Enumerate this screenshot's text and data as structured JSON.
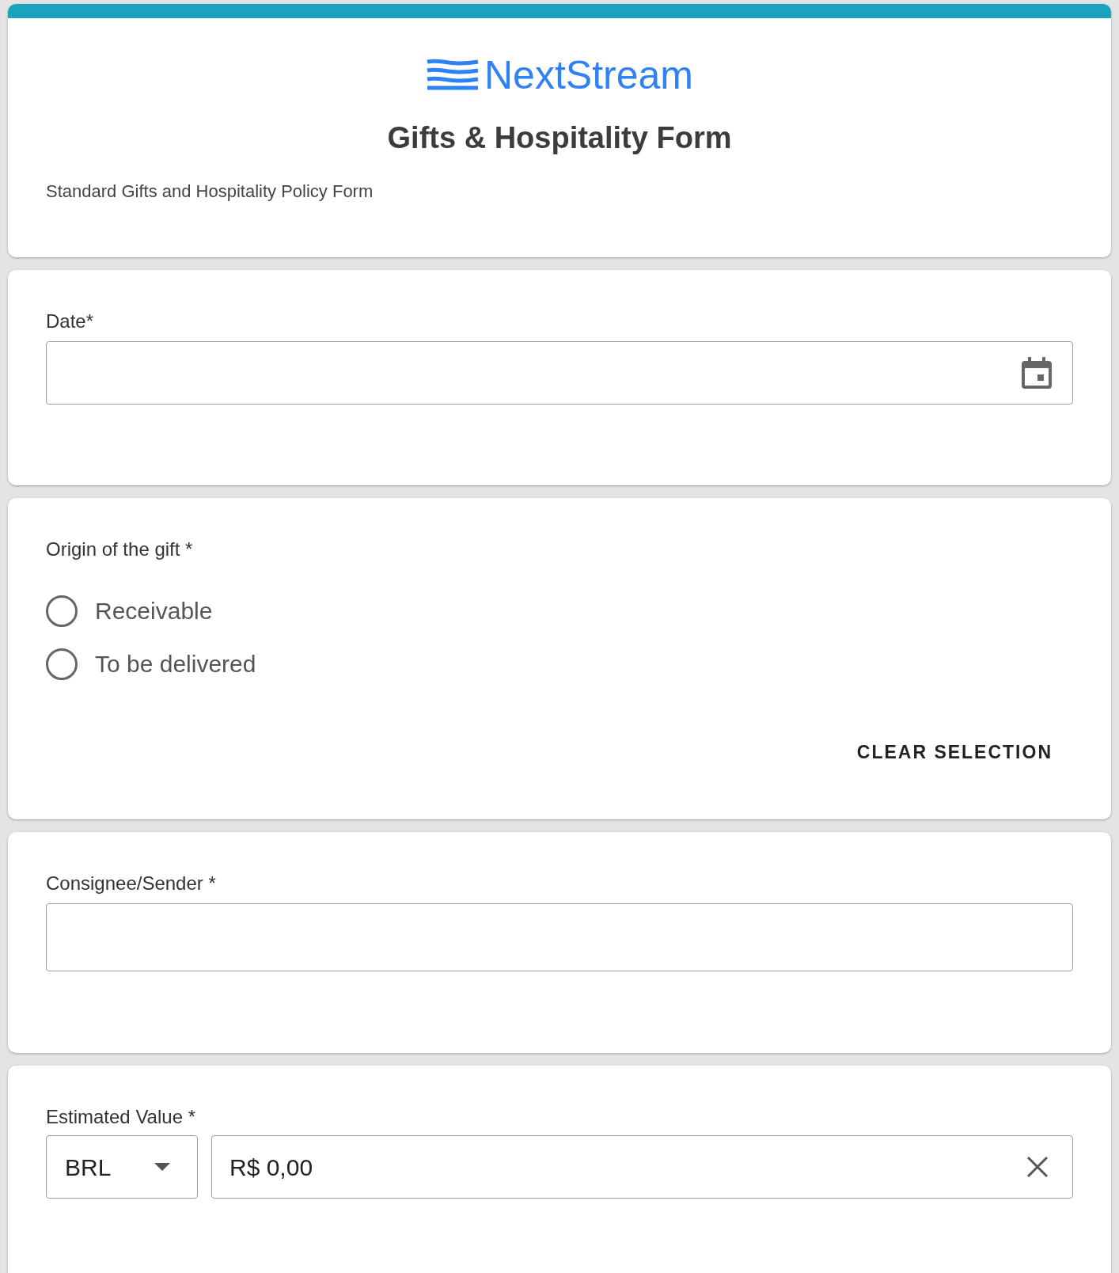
{
  "header": {
    "brand": "NextStream",
    "title": "Gifts & Hospitality Form",
    "description": "Standard Gifts and Hospitality Policy Form"
  },
  "date_field": {
    "label": "Date*"
  },
  "origin": {
    "label": "Origin of the gift *",
    "options": [
      {
        "label": "Receivable",
        "selected": false
      },
      {
        "label": "To be delivered",
        "selected": false
      }
    ],
    "clear_button": "CLEAR SELECTION"
  },
  "consignee_field": {
    "label": "Consignee/Sender *"
  },
  "estimated_value": {
    "label": "Estimated Value *",
    "currency": "BRL",
    "value": "R$ 0,00"
  }
}
